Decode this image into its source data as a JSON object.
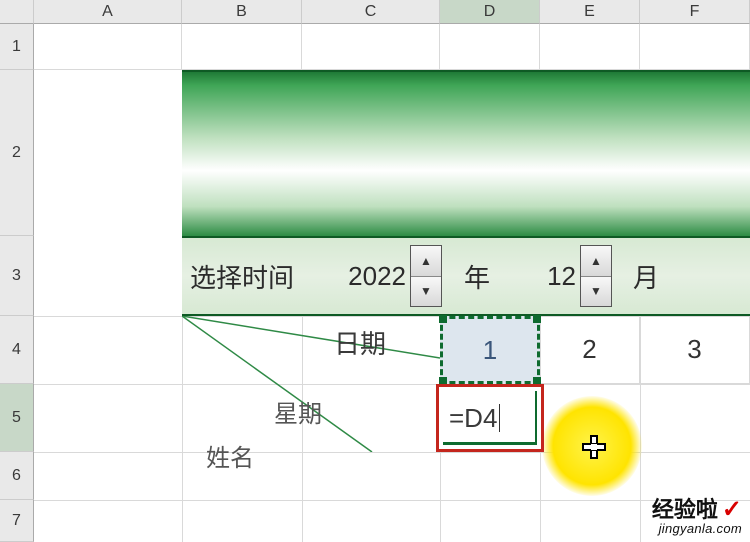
{
  "columns": [
    "A",
    "B",
    "C",
    "D",
    "E",
    "F"
  ],
  "rows": [
    "1",
    "2",
    "3",
    "4",
    "5",
    "6",
    "7"
  ],
  "selected_column": "D",
  "selected_row": "5",
  "select_bar": {
    "label": "选择时间",
    "year": "2022",
    "year_unit": "年",
    "month": "12",
    "month_unit": "月"
  },
  "diag": {
    "date_label": "日期",
    "week_label": "星期",
    "name_label": "姓名"
  },
  "row4": {
    "D": "1",
    "E": "2",
    "F": "3"
  },
  "editing": {
    "cell": "D5",
    "formula": "=D4"
  },
  "watermark": {
    "zh": "经验啦",
    "en": "jingyanla.com"
  },
  "chart_data": {
    "type": "table",
    "note": "Spreadsheet fragment; D5 is being edited with formula =D4 referencing D4 (value 1). Row 4 dates are 1,2,3 for columns D,E,F. Year 2022, month 12 selected via spinners.",
    "columns": [
      "A",
      "B",
      "C",
      "D",
      "E",
      "F"
    ],
    "data_rows": [
      {
        "row": 3,
        "B": "选择时间",
        "C": "2022",
        "D": "年",
        "E": "12",
        "F": "月"
      },
      {
        "row": 4,
        "C": "日期",
        "D": 1,
        "E": 2,
        "F": 3
      },
      {
        "row": 5,
        "B": "姓名",
        "C_area_label": "星期",
        "D": "=D4"
      }
    ]
  }
}
